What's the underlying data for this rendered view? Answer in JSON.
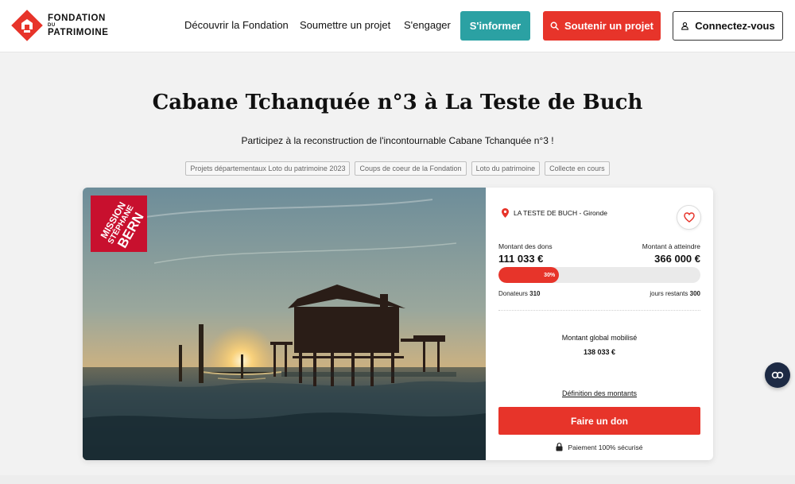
{
  "header": {
    "logo": {
      "line1": "FONDATION",
      "line2": "DU",
      "line3": "PATRIMOINE",
      "color": "#e7342a"
    },
    "nav": [
      "Découvrir la Fondation",
      "Soumettre un projet",
      "S'engager"
    ],
    "btn_info": "S'informer",
    "btn_support": "Soutenir un projet",
    "btn_login": "Connectez-vous"
  },
  "page": {
    "title": "Cabane Tchanquée n°3 à La Teste de Buch",
    "subtitle": "Participez à la reconstruction de l'incontournable Cabane Tchanquée n°3 !",
    "tags": [
      "Projets départementaux Loto du patrimoine 2023",
      "Coups de coeur de la Fondation",
      "Loto du patrimoine",
      "Collecte en cours"
    ]
  },
  "badge": {
    "line1": "MISSION",
    "line2": "STÉPHANE",
    "line3": "BERN"
  },
  "panel": {
    "location": "LA TESTE DE BUCH - Gironde",
    "raised_label": "Montant des dons",
    "raised_value": "111 033 €",
    "goal_label": "Montant à atteindre",
    "goal_value": "366 000 €",
    "progress_percent": 30,
    "progress_label": "30%",
    "donors_label": "Donateurs",
    "donors_value": "310",
    "days_label": "jours restants",
    "days_value": "300",
    "global_label": "Montant global mobilisé",
    "global_value": "138 033 €",
    "definition_link": "Définition des montants",
    "donate_button": "Faire un don",
    "secure_text": "Paiement 100% sécurisé"
  },
  "colors": {
    "accent_red": "#e7342a",
    "teal": "#2ba1a3",
    "badge_red": "#c8102e",
    "navy": "#1d2a44"
  }
}
